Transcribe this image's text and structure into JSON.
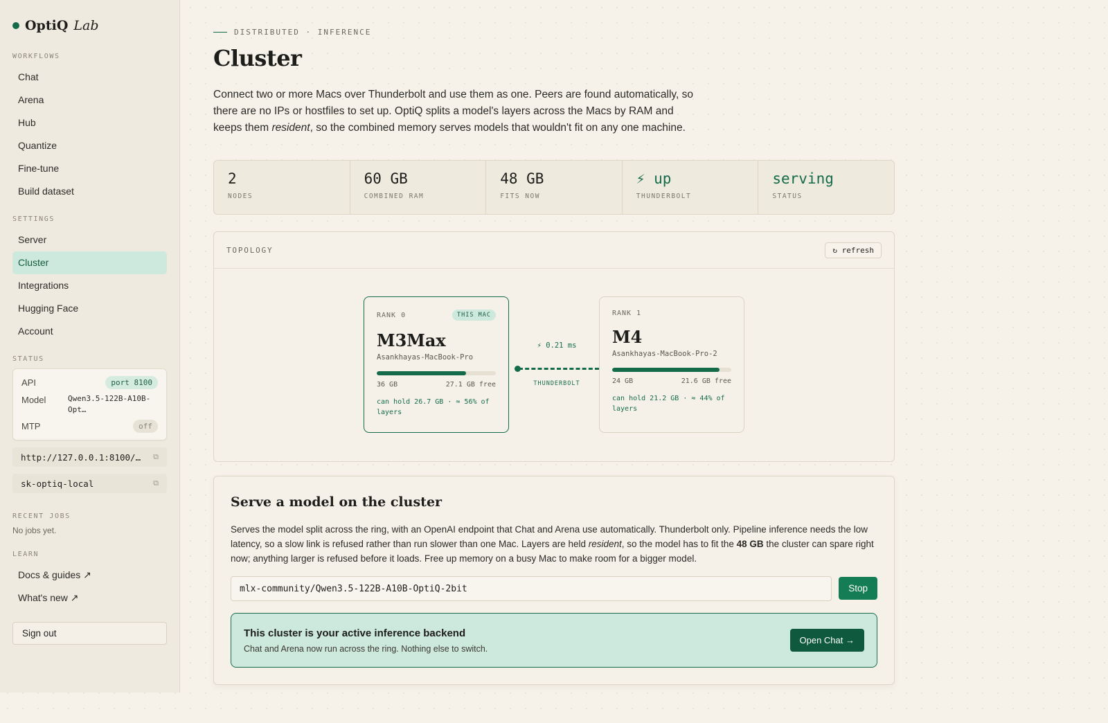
{
  "brand": {
    "name": "OptiQ",
    "suffix": "Lab"
  },
  "sidebar": {
    "workflows_title": "WORKFLOWS",
    "workflows": [
      "Chat",
      "Arena",
      "Hub",
      "Quantize",
      "Fine-tune",
      "Build dataset"
    ],
    "settings_title": "SETTINGS",
    "settings": [
      "Server",
      "Cluster",
      "Integrations",
      "Hugging Face",
      "Account"
    ],
    "active_item": "Cluster",
    "status_title": "STATUS",
    "status": {
      "api_label": "API",
      "api_value": "port 8100",
      "model_label": "Model",
      "model_value": "Qwen3.5-122B-A10B-Opt…",
      "mtp_label": "MTP",
      "mtp_value": "off"
    },
    "endpoint_url": "http://127.0.0.1:8100/…",
    "api_key": "sk-optiq-local",
    "recent_jobs_title": "RECENT JOBS",
    "recent_jobs_empty": "No jobs yet.",
    "learn_title": "LEARN",
    "learn": [
      "Docs & guides ↗",
      "What's new ↗"
    ],
    "sign_out": "Sign out"
  },
  "main": {
    "eyebrow": "DISTRIBUTED · INFERENCE",
    "title": "Cluster",
    "intro_1": "Connect two or more Macs over Thunderbolt and use them as one. Peers are found automatically, so there are no IPs or hostfiles to set up. OptiQ splits a model's layers across the Macs by RAM and keeps them ",
    "intro_em": "resident",
    "intro_2": ", so the combined memory serves models that wouldn't fit on any one machine.",
    "stats": [
      {
        "value": "2",
        "label": "NODES",
        "accent": false
      },
      {
        "value": "60 GB",
        "label": "COMBINED RAM",
        "accent": false
      },
      {
        "value": "48 GB",
        "label": "FITS NOW",
        "accent": false
      },
      {
        "value": "⚡ up",
        "label": "THUNDERBOLT",
        "accent": true
      },
      {
        "value": "serving",
        "label": "STATUS",
        "accent": true
      }
    ],
    "topology": {
      "title": "TOPOLOGY",
      "refresh_label": "↻ refresh",
      "link_latency": "⚡ 0.21 ms",
      "link_type": "THUNDERBOLT",
      "nodes": [
        {
          "rank": "RANK 0",
          "badge": "THIS MAC",
          "name": "M3Max",
          "host": "Asankhayas-MacBook-Pro",
          "ram": "36 GB",
          "free": "27.1 GB free",
          "used_fraction": 0.75,
          "hold": "can hold 26.7 GB · ≈ 56% of layers"
        },
        {
          "rank": "RANK 1",
          "badge": "",
          "name": "M4",
          "host": "Asankhayas-MacBook-Pro-2",
          "ram": "24 GB",
          "free": "21.6 GB free",
          "used_fraction": 0.9,
          "hold": "can hold 21.2 GB · ≈ 44% of layers"
        }
      ]
    },
    "serve": {
      "title": "Serve a model on the cluster",
      "desc_1": "Serves the model split across the ring, with an OpenAI endpoint that Chat and Arena use automatically. Thunderbolt only. Pipeline inference needs the low latency, so a slow link is refused rather than run slower than one Mac. Layers are held ",
      "desc_em": "resident",
      "desc_2": ", so the model has to fit the ",
      "desc_strong": "48 GB",
      "desc_3": " the cluster can spare right now; anything larger is refused before it loads. Free up memory on a busy Mac to make room for a bigger model.",
      "model_value": "mlx-community/Qwen3.5-122B-A10B-OptiQ-2bit",
      "stop_label": "Stop",
      "active_title": "This cluster is your active inference backend",
      "active_sub": "Chat and Arena now run across the ring. Nothing else to switch.",
      "open_chat_label": "Open Chat →"
    }
  },
  "colors": {
    "accent": "#146b4a",
    "accent_soft": "#cde8dc",
    "background": "#f6f2e9"
  }
}
